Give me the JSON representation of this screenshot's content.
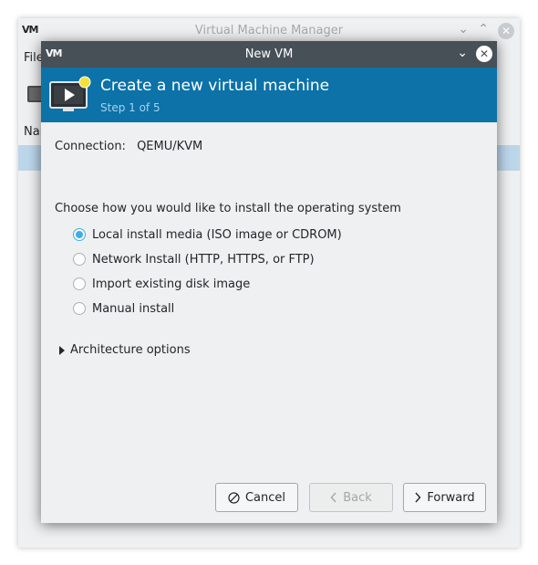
{
  "parent": {
    "title": "Virtual Machine Manager",
    "logo": "VM",
    "menu_file": "File",
    "column_name": "Name"
  },
  "dialog": {
    "title": "New VM",
    "logo": "VM",
    "banner": {
      "title": "Create a new virtual machine",
      "step": "Step 1 of 5"
    },
    "connection_label": "Connection:",
    "connection_value": "QEMU/KVM",
    "choose_label": "Choose how you would like to install the operating system",
    "options": [
      {
        "label": "Local install media (ISO image or CDROM)",
        "checked": true
      },
      {
        "label": "Network Install (HTTP, HTTPS, or FTP)",
        "checked": false
      },
      {
        "label": "Import existing disk image",
        "checked": false
      },
      {
        "label": "Manual install",
        "checked": false
      }
    ],
    "architecture_label": "Architecture options",
    "buttons": {
      "cancel": "Cancel",
      "back": "Back",
      "forward": "Forward"
    }
  },
  "colors": {
    "banner": "#0c72a8",
    "titlebar": "#475057",
    "accent": "#3daee9",
    "selection": "#bcd6ea"
  }
}
